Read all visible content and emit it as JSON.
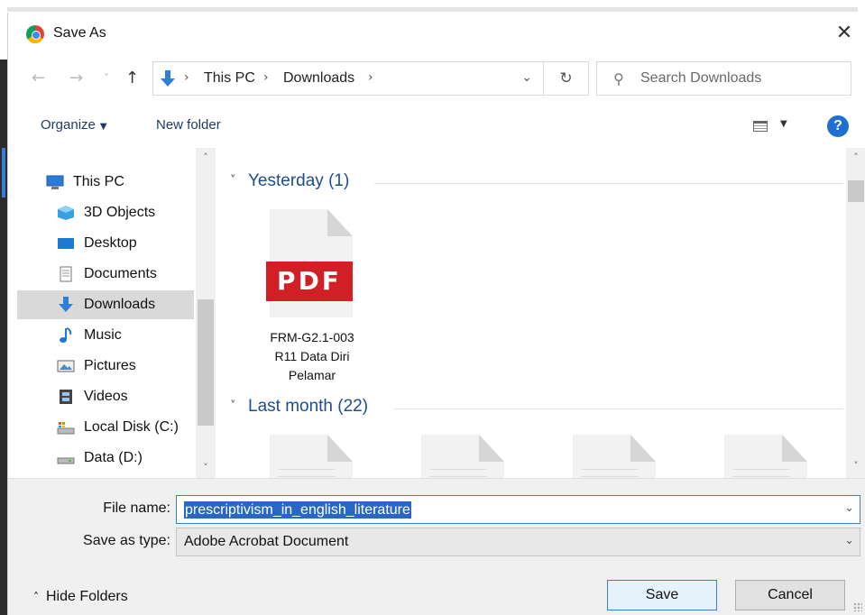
{
  "window": {
    "title": "Save As",
    "close_glyph": "✕"
  },
  "nav": {
    "back_glyph": "←",
    "forward_glyph": "→",
    "recent_glyph": "˅",
    "up_glyph": "↑",
    "breadcrumb": [
      "This PC",
      "Downloads"
    ],
    "crumb_sep": "›",
    "dropdown_glyph": "⌄",
    "refresh_glyph": "↻",
    "search_glyph": "⚲",
    "search_placeholder": "Search Downloads"
  },
  "toolbar": {
    "organize_label": "Organize",
    "caret_glyph": "▼",
    "new_folder_label": "New folder",
    "help_label": "?"
  },
  "sidebar": {
    "items": [
      {
        "label": "This PC",
        "icon": "computer-icon"
      },
      {
        "label": "3D Objects",
        "icon": "cube-icon"
      },
      {
        "label": "Desktop",
        "icon": "desktop-icon"
      },
      {
        "label": "Documents",
        "icon": "document-icon"
      },
      {
        "label": "Downloads",
        "icon": "download-icon",
        "selected": true
      },
      {
        "label": "Music",
        "icon": "music-note-icon"
      },
      {
        "label": "Pictures",
        "icon": "picture-icon"
      },
      {
        "label": "Videos",
        "icon": "film-icon"
      },
      {
        "label": "Local Disk (C:)",
        "icon": "drive-icon"
      },
      {
        "label": "Data (D:)",
        "icon": "drive-icon"
      }
    ],
    "scroll_up": "˄",
    "scroll_down": "˅"
  },
  "content": {
    "groups": [
      {
        "label": "Yesterday (1)",
        "caret": "˅"
      },
      {
        "label": "Last month (22)",
        "caret": "˅"
      }
    ],
    "files": [
      {
        "badge": "PDF",
        "name_lines": [
          "FRM-G2.1-003",
          "R11 Data Diri",
          "Pelamar"
        ]
      }
    ],
    "scroll_up": "˄",
    "scroll_down": "˅"
  },
  "form": {
    "filename_label": "File name:",
    "filename_value": "prescriptivism_in_english_literature",
    "savetype_label": "Save as type:",
    "savetype_value": "Adobe Acrobat Document",
    "dropdown_glyph": "⌄",
    "hide_folders_label": "Hide Folders",
    "hide_caret": "˄",
    "save_label": "Save",
    "cancel_label": "Cancel"
  },
  "colors": {
    "accent": "#2a66c4",
    "pdf_red": "#d21f26",
    "group_heading": "#1e4e8c"
  }
}
